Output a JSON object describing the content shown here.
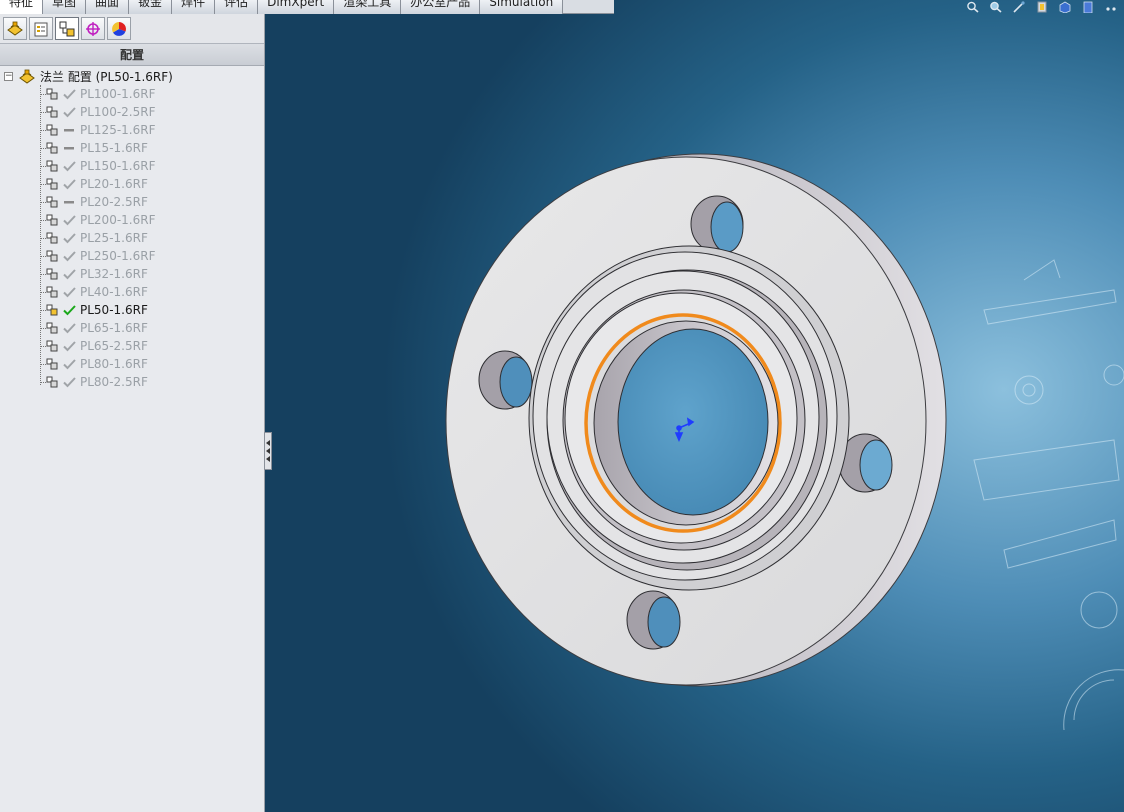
{
  "tabs": [
    "特征",
    "草图",
    "曲面",
    "钣金",
    "焊件",
    "评估",
    "DimXpert",
    "渲染工具",
    "办公室产品",
    "Simulation"
  ],
  "active_tab_index": 0,
  "panel": {
    "toolbar_icons": [
      "feature-manager-icon",
      "property-manager-icon",
      "configuration-manager-icon",
      "dimxpert-manager-icon",
      "display-manager-icon"
    ],
    "title": "配置",
    "root_label": "法兰 配置  (PL50-1.6RF)",
    "items": [
      {
        "label": "PL100-1.6RF",
        "state": "check"
      },
      {
        "label": "PL100-2.5RF",
        "state": "check"
      },
      {
        "label": "PL125-1.6RF",
        "state": "dash"
      },
      {
        "label": "PL15-1.6RF",
        "state": "dash"
      },
      {
        "label": "PL150-1.6RF",
        "state": "check"
      },
      {
        "label": "PL20-1.6RF",
        "state": "check"
      },
      {
        "label": "PL20-2.5RF",
        "state": "dash"
      },
      {
        "label": "PL200-1.6RF",
        "state": "check"
      },
      {
        "label": "PL25-1.6RF",
        "state": "check"
      },
      {
        "label": "PL250-1.6RF",
        "state": "check"
      },
      {
        "label": "PL32-1.6RF",
        "state": "check"
      },
      {
        "label": "PL40-1.6RF",
        "state": "check"
      },
      {
        "label": "PL50-1.6RF",
        "state": "active"
      },
      {
        "label": "PL65-1.6RF",
        "state": "check"
      },
      {
        "label": "PL65-2.5RF",
        "state": "check"
      },
      {
        "label": "PL80-1.6RF",
        "state": "check"
      },
      {
        "label": "PL80-2.5RF",
        "state": "check"
      }
    ]
  },
  "viewport": {
    "view_tools": [
      "zoom-to-fit-icon",
      "zoom-to-area-icon",
      "previous-view-icon",
      "section-view-icon",
      "view-orientation-icon",
      "display-style-icon",
      "hide-show-icon"
    ],
    "model": "flange",
    "colors": {
      "selection_edge": "#f08a1c",
      "triad": "#1f3cff"
    }
  },
  "colors": {
    "panel_bg": "#e8eaee",
    "active_check": "#1aa81a",
    "inactive_text": "#9aa0a6"
  }
}
